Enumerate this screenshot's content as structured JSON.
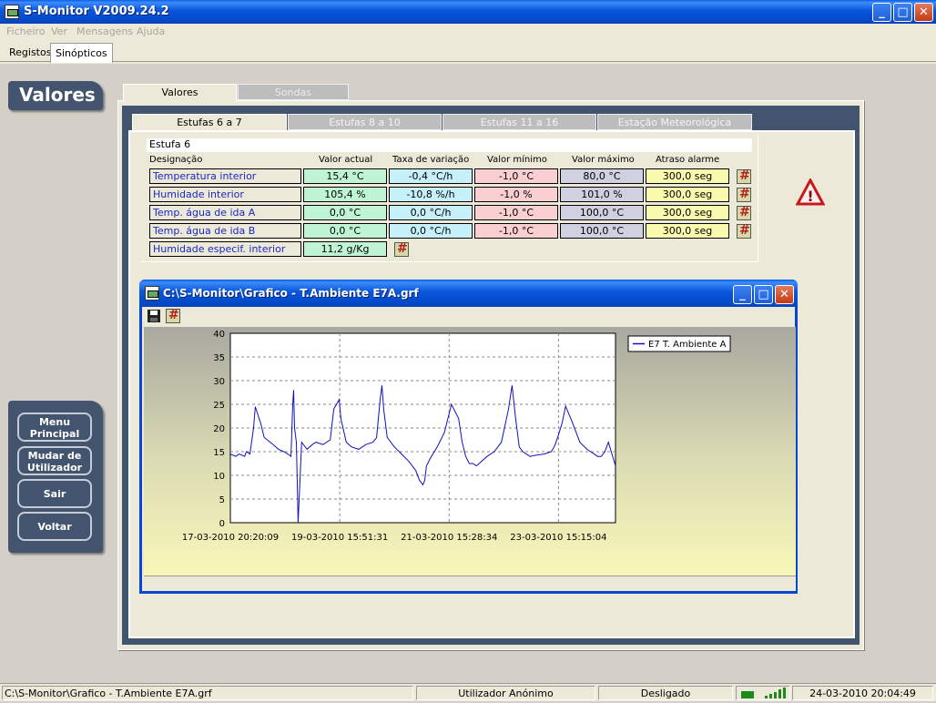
{
  "app": {
    "title": "S-Monitor V2009.24.2"
  },
  "menu": [
    "Ficheiro",
    "Ver",
    "Mensagens",
    "Ajuda"
  ],
  "top_tabs": [
    "Registos",
    "Sinópticos"
  ],
  "panel_title": "Valores",
  "nav": {
    "menu_principal": "Menu Principal",
    "mudar_utilizador": "Mudar de Utilizador",
    "sair": "Sair",
    "voltar": "Voltar"
  },
  "outer_tabs": [
    "Valores",
    "Sondas"
  ],
  "inner_tabs": [
    "Estufas 6 a 7",
    "Estufas 8 a 10",
    "Estufas 11 a 16",
    "Estação Meteorológica"
  ],
  "estufa": "Estufa 6",
  "table": {
    "headers": [
      "Designação",
      "Valor actual",
      "Taxa de variação",
      "Valor mínimo",
      "Valor máximo",
      "Atraso alarme"
    ],
    "rows": [
      {
        "name": "Temperatura interior",
        "actual": "15,4 °C",
        "taxa": "-0,4 °C/h",
        "min": "-1,0 °C",
        "max": "80,0 °C",
        "atraso": "300,0 seg"
      },
      {
        "name": "Humidade interior",
        "actual": "105,4 %",
        "taxa": "-10,8 %/h",
        "min": "-1,0 %",
        "max": "101,0 %",
        "atraso": "300,0 seg"
      },
      {
        "name": "Temp. água de ida A",
        "actual": "0,0 °C",
        "taxa": "0,0 °C/h",
        "min": "-1,0 °C",
        "max": "100,0 °C",
        "atraso": "300,0 seg"
      },
      {
        "name": "Temp. água de ida B",
        "actual": "0,0 °C",
        "taxa": "0,0 °C/h",
        "min": "-1,0 °C",
        "max": "100,0 °C",
        "atraso": "300,0 seg"
      }
    ],
    "extra": {
      "name": "Humidade especif. interior",
      "actual": "11,2 g/Kg"
    }
  },
  "graph_window": {
    "title": "C:\\S-Monitor\\Grafico - T.Ambiente E7A.grf"
  },
  "chart_data": {
    "type": "line",
    "title": "",
    "xlabel": "",
    "ylabel": "",
    "ylim": [
      0,
      40
    ],
    "yticks": [
      0,
      5,
      10,
      15,
      20,
      25,
      30,
      35,
      40
    ],
    "xticks": [
      "17-03-2010 20:20:09",
      "19-03-2010 15:51:31",
      "21-03-2010 15:28:34",
      "23-03-2010 15:15:04"
    ],
    "grid": true,
    "legend": "top-right",
    "series": [
      {
        "name": "E7 T. Ambiente A",
        "color": "#1010c0",
        "x_hours": [
          0,
          3,
          5,
          8,
          9,
          11,
          13,
          14,
          17,
          19,
          24,
          27,
          30,
          33,
          34,
          35,
          35.5,
          36,
          37,
          38,
          40,
          43,
          46,
          48,
          52,
          56,
          58,
          61,
          62,
          65,
          68,
          72,
          76,
          80,
          82,
          84,
          85,
          86,
          88,
          92,
          96,
          100,
          104,
          106,
          108,
          109,
          110,
          112,
          116,
          120,
          124,
          128,
          130,
          132,
          134,
          136,
          138,
          141,
          144,
          148,
          152,
          156,
          158,
          160,
          162,
          164,
          168,
          172,
          176,
          180,
          182,
          184,
          186,
          188,
          192,
          196,
          200,
          204,
          206,
          208,
          210,
          212,
          216
        ],
        "values": [
          14.5,
          14,
          14.5,
          14,
          15,
          14.5,
          20,
          24.5,
          21,
          18,
          16.5,
          15.5,
          15,
          14.3,
          14,
          25,
          28,
          20,
          17,
          0,
          17,
          15.5,
          16.5,
          17,
          16.5,
          17.5,
          24,
          26,
          22,
          17,
          16,
          15.5,
          16.5,
          17,
          18,
          26,
          29,
          24,
          18,
          16,
          14.5,
          13,
          11,
          9,
          8,
          9,
          12,
          13.5,
          16,
          19,
          25,
          22,
          17,
          14,
          12.5,
          12.5,
          12,
          13,
          14,
          15,
          17,
          24,
          29,
          22,
          16,
          15,
          14,
          14.3,
          14.5,
          15,
          16.3,
          18.5,
          21,
          24.6,
          21,
          17,
          15.5,
          14.5,
          14,
          14,
          15,
          17,
          12
        ]
      }
    ]
  },
  "status": {
    "path": "C:\\S-Monitor\\Grafico - T.Ambiente E7A.grf",
    "user": "Utilizador Anónimo",
    "connection": "Desligado",
    "datetime": "24-03-2010 20:04:49"
  }
}
